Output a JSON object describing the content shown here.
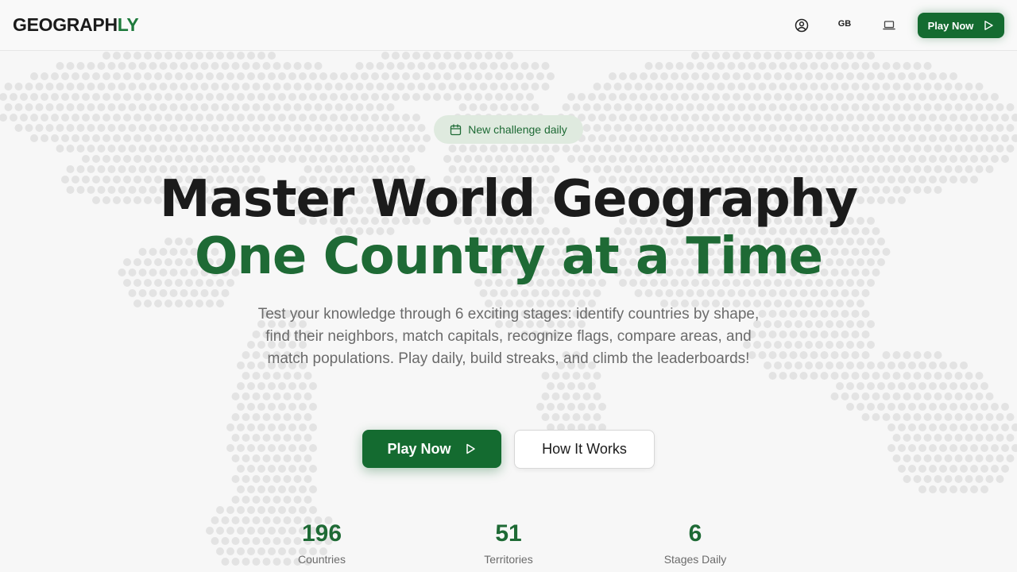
{
  "header": {
    "logo_main": "GEOGRAPH",
    "logo_accent": "LY",
    "language": "GB",
    "play_label": "Play Now",
    "icons": [
      "user-icon",
      "laptop-icon",
      "play-icon"
    ]
  },
  "hero": {
    "badge": "New challenge daily",
    "title_line1": "Master World Geography",
    "title_line2": "One Country at a Time",
    "subtitle": "Test your knowledge through 6 exciting stages: identify countries by shape, find their neighbors, match capitals, recognize flags, compare areas, and match populations. Play daily, build streaks, and climb the leaderboards!",
    "primary_label": "Play Now",
    "secondary_label": "How It Works"
  },
  "stats": [
    {
      "value": "196",
      "label": "Countries"
    },
    {
      "value": "51",
      "label": "Territories"
    },
    {
      "value": "6",
      "label": "Stages Daily"
    }
  ],
  "colors": {
    "brand": "#146b30",
    "brand_text": "#1e6a35",
    "badge_bg": "#dfeadf",
    "background": "#f7f7f7"
  }
}
